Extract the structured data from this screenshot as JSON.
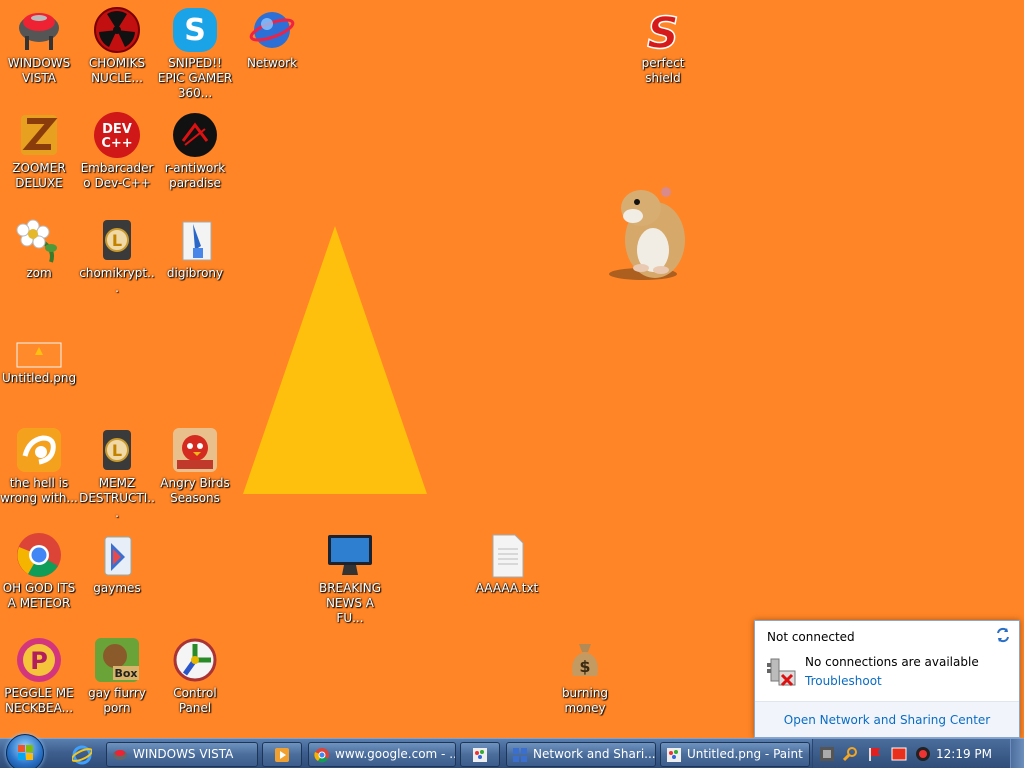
{
  "desktop": {
    "background_color": "#ff8526",
    "icons": [
      {
        "label": "WINDOWS VISTA",
        "icon": "grill-icon"
      },
      {
        "label": "CHOMIKS NUCLE...",
        "icon": "radiation-icon"
      },
      {
        "label": "SNIPED!! EPIC GAMER 360...",
        "icon": "skype-icon"
      },
      {
        "label": "Network",
        "icon": "network-globe-icon"
      },
      {
        "label": "ZOOMER DELUXE",
        "icon": "zoomer-icon"
      },
      {
        "label": "Embarcadero Dev-C++",
        "icon": "devcpp-icon"
      },
      {
        "label": "r-antiwork paradise",
        "icon": "antiwork-icon"
      },
      {
        "label": "zom",
        "icon": "flower-icon"
      },
      {
        "label": "chomikrypt...",
        "icon": "shortcut-l-icon"
      },
      {
        "label": "digibrony",
        "icon": "document-brush-icon"
      },
      {
        "label": "Untitled.png",
        "icon": "image-file-icon"
      },
      {
        "label": "the hell is wrong with...",
        "icon": "uc-browser-icon"
      },
      {
        "label": "MEMZ DESTRUCTI...",
        "icon": "shortcut-l-icon"
      },
      {
        "label": "Angry Birds Seasons",
        "icon": "angry-birds-icon"
      },
      {
        "label": "OH GOD ITS A METEOR",
        "icon": "chrome-icon"
      },
      {
        "label": "gaymes",
        "icon": "games-folder-icon"
      },
      {
        "label": "BREAKING NEWS A FU...",
        "icon": "monitor-icon"
      },
      {
        "label": "AAAAA.txt",
        "icon": "text-file-icon"
      },
      {
        "label": "PEGGLE ME NECKBEA...",
        "icon": "peggle-icon"
      },
      {
        "label": "gay fiurry porn",
        "icon": "box-beaver-icon"
      },
      {
        "label": "Control Panel",
        "icon": "control-panel-icon"
      },
      {
        "label": "burning money",
        "icon": "money-bag-icon"
      },
      {
        "label": "perfect shield",
        "icon": "shield-s-icon"
      }
    ]
  },
  "taskbar": {
    "start_icon": "windows-start-orb-icon",
    "quick_launch": [
      {
        "icon": "internet-explorer-icon"
      }
    ],
    "buttons": [
      {
        "label": "WINDOWS VISTA",
        "icon": "grill-icon"
      },
      {
        "label": "",
        "icon": "media-player-icon"
      },
      {
        "label": "www.google.com - ...",
        "icon": "chrome-icon"
      },
      {
        "label": "",
        "icon": "paint-icon"
      },
      {
        "label": "Network and Shari...",
        "icon": "network-sharing-icon"
      },
      {
        "label": "Untitled.png - Paint",
        "icon": "paint-icon"
      }
    ],
    "tray_icons": [
      "tray-app-icon",
      "search-icon",
      "flag-icon",
      "red-app-icon",
      "record-icon"
    ],
    "clock": "12:19 PM"
  },
  "network_flyout": {
    "title": "Not connected",
    "message": "No connections are available",
    "troubleshoot_link": "Troubleshoot",
    "footer_link": "Open Network and Sharing Center"
  }
}
